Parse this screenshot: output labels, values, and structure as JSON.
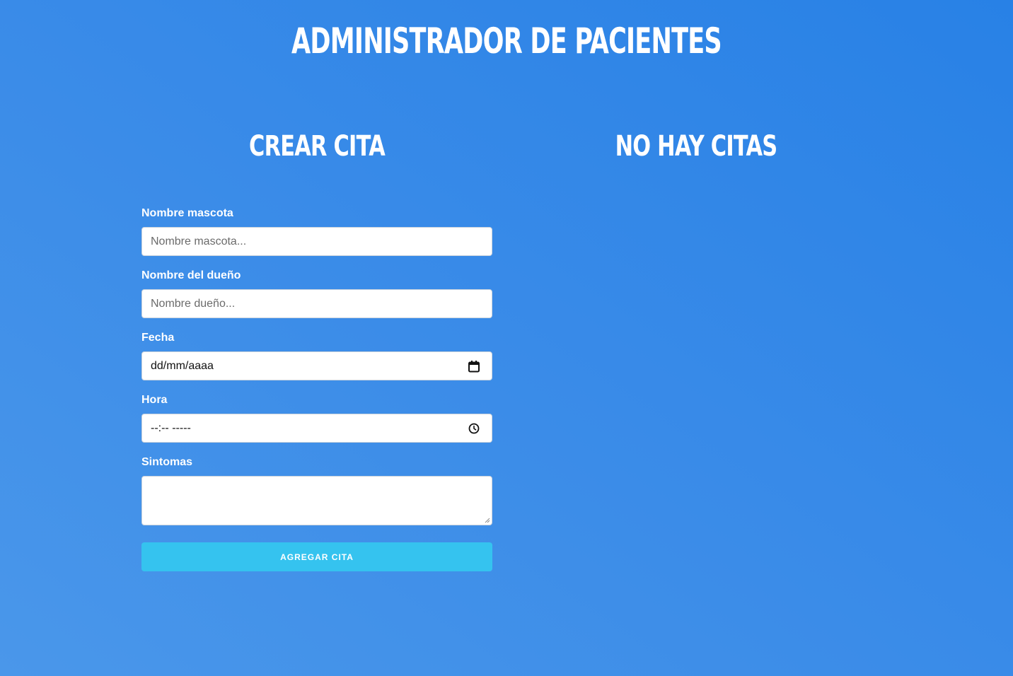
{
  "header": {
    "title": "Administrador de pacientes"
  },
  "form_section": {
    "title": "Crear cita",
    "fields": {
      "pet_name": {
        "label": "Nombre mascota",
        "placeholder": "Nombre mascota..."
      },
      "owner_name": {
        "label": "Nombre del dueño",
        "placeholder": "Nombre dueño..."
      },
      "date": {
        "label": "Fecha",
        "value": "dd/mm/aaaa",
        "icon": "calendar-icon"
      },
      "time": {
        "label": "Hora",
        "value": "--:-- -----",
        "icon": "clock-icon"
      },
      "symptoms": {
        "label": "Sintomas",
        "value": ""
      }
    },
    "submit_label": "Agregar cita"
  },
  "appointments_section": {
    "title": "No hay citas"
  },
  "colors": {
    "background_start": "#4a97ea",
    "background_end": "#2881e6",
    "button": "#35c3ef",
    "text": "#ffffff"
  }
}
